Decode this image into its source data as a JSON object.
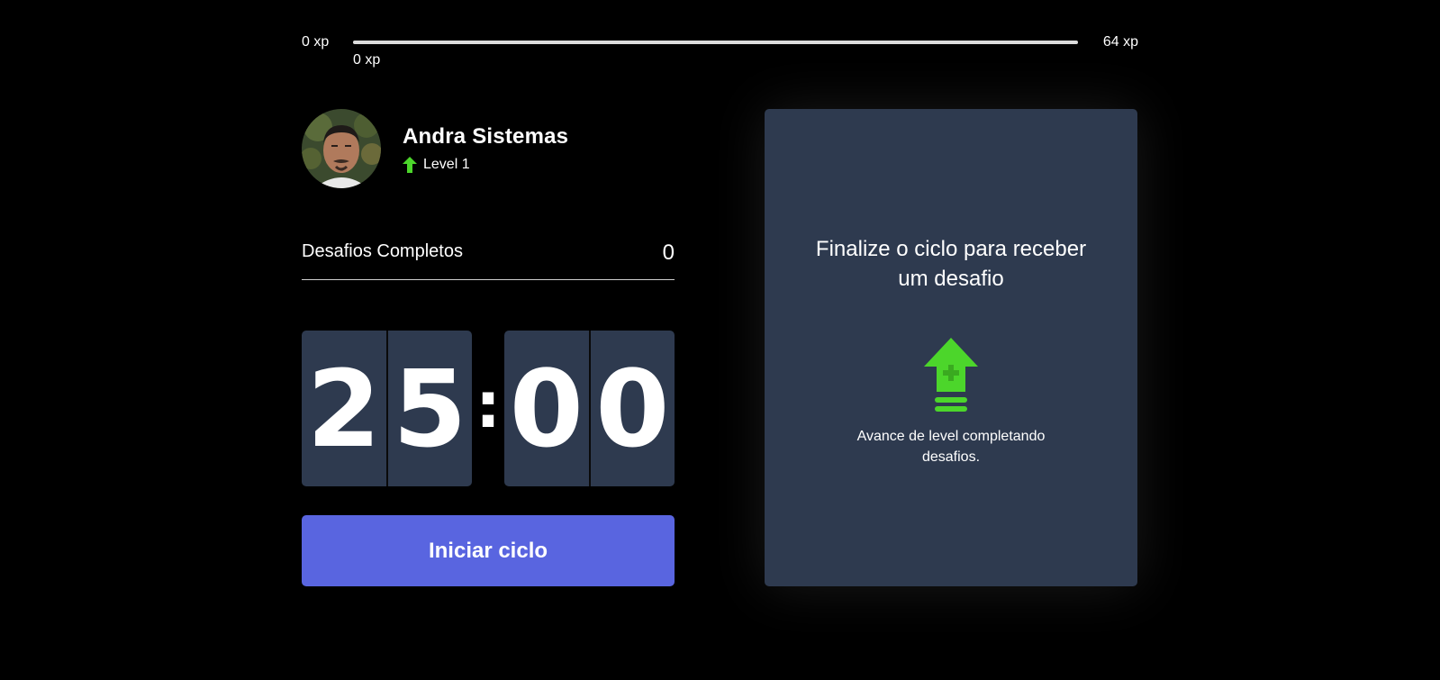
{
  "experience": {
    "min_label": "0 xp",
    "max_label": "64 xp",
    "current_label": "0 xp",
    "progress_percent": 100
  },
  "profile": {
    "name": "Andra Sistemas",
    "level_label": "Level 1",
    "level_icon": "level-up-arrow-icon"
  },
  "completed_challenges": {
    "label": "Desafios Completos",
    "count": "0"
  },
  "countdown": {
    "minute_left": "2",
    "minute_right": "5",
    "separator": ":",
    "second_left": "0",
    "second_right": "0"
  },
  "start_button": {
    "label": "Iniciar ciclo"
  },
  "challenge_box": {
    "title": "Finalize o ciclo para receber um desafio",
    "icon": "level-up-icon",
    "description": "Avance de level completando desafios."
  },
  "colors": {
    "background": "#000000",
    "card": "#2e3a4f",
    "button": "#5965e0",
    "accent_green": "#4cd62b",
    "progress_fill": "#dcdcdc"
  }
}
